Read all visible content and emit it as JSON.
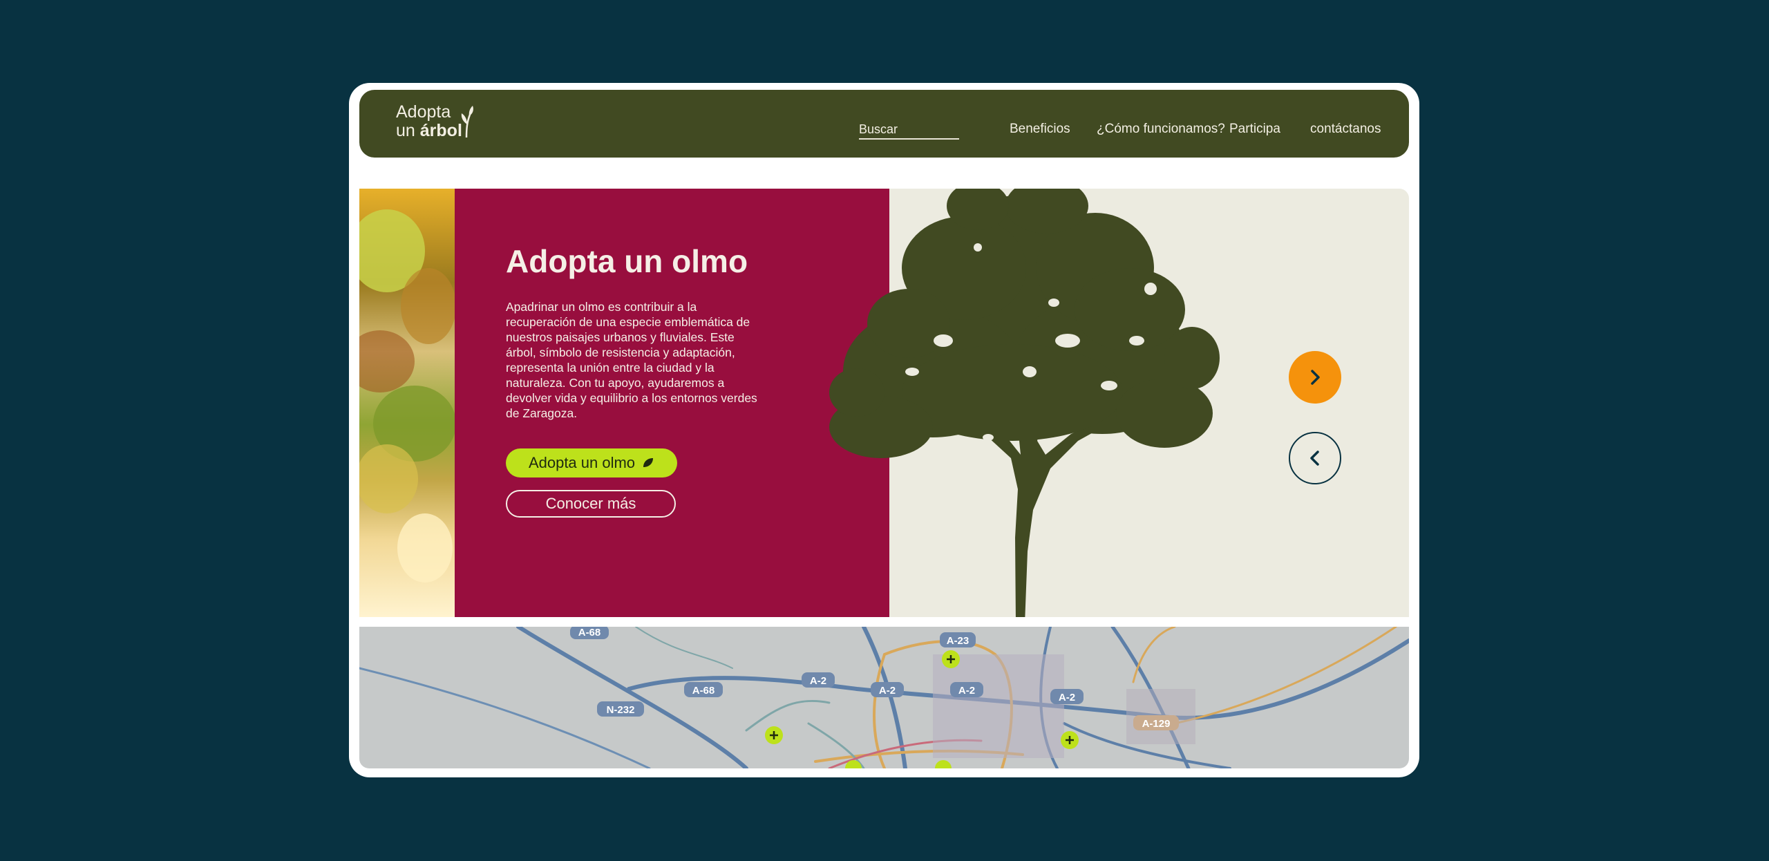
{
  "logo": {
    "line1": "Adopta",
    "line2_prefix": "un ",
    "line2_bold": "árbol"
  },
  "nav": {
    "search_placeholder": "Buscar",
    "links": [
      "Beneficios",
      "¿Cómo funcionamos?",
      "Participa",
      "contáctanos"
    ]
  },
  "hero": {
    "title": "Adopta un olmo",
    "description": "Apadrinar un olmo es contribuir a la recuperación de una especie emblemática de nuestros paisajes urbanos y fluviales. Este árbol, símbolo de resistencia y adaptación, representa la unión entre la ciudad y la naturaleza. Con tu apoyo, ayudaremos a devolver vida y equilibrio a los entornos verdes de Zaragoza.",
    "primary_button": "Adopta un olmo",
    "secondary_button": "Conocer más"
  },
  "map": {
    "road_labels": [
      "A-68",
      "A-23",
      "A-68",
      "A-2",
      "A-2",
      "A-2",
      "A-2",
      "N-232",
      "A-129"
    ]
  },
  "colors": {
    "background": "#083241",
    "navbar": "#414a22",
    "hero_panel": "#980e3e",
    "primary_button": "#bde11b",
    "next_arrow": "#f5920c",
    "tree": "#414a22"
  }
}
